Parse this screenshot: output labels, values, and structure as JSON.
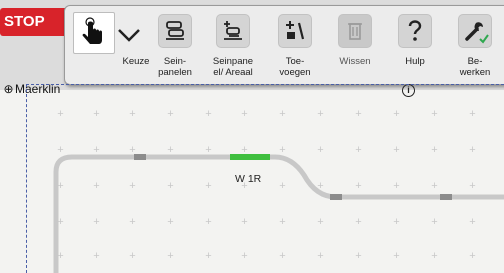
{
  "stop_button": {
    "label": "STOP"
  },
  "toolbar": {
    "tools": [
      {
        "name": "keuze",
        "label": "Keuze",
        "icon": "pointer-hand-icon"
      },
      {
        "name": "seinpanelen",
        "label": "Sein-\npanelen",
        "icon": "panels-icon"
      },
      {
        "name": "seinpanelen-areaal",
        "label": "Seinpane\nel/ Areaal",
        "icon": "panel-area-icon"
      },
      {
        "name": "toevoegen",
        "label": "Toe-\nvoegen",
        "icon": "add-icon"
      },
      {
        "name": "wissen",
        "label": "Wissen",
        "icon": "trash-icon",
        "disabled": true
      },
      {
        "name": "hulp",
        "label": "Hulp",
        "icon": "question-icon"
      },
      {
        "name": "bewerken",
        "label": "Be-\nwerken",
        "icon": "wrench-icon"
      }
    ]
  },
  "layout": {
    "title": "Maerklin",
    "turnout_label": "W 1R"
  },
  "colors": {
    "stop": "#d8232a",
    "track": "#c8c8c8",
    "turnout_active": "#3fbf3f",
    "grid": "#c8c8c8"
  }
}
